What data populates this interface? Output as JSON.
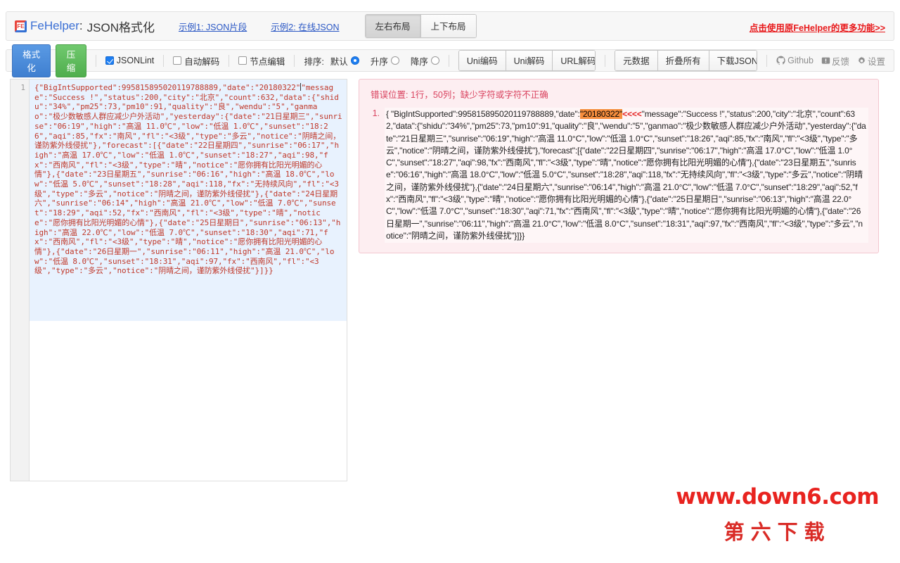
{
  "header": {
    "brand_logo_text": "FE",
    "brand_name": "FeHelper",
    "brand_colon": ":",
    "brand_title": "JSON格式化",
    "links": [
      {
        "label": "示例1: JSON片段"
      },
      {
        "label": "示例2: 在线JSON"
      }
    ],
    "layout_buttons": [
      {
        "label": "左右布局",
        "active": true
      },
      {
        "label": "上下布局",
        "active": false
      }
    ],
    "right_link": "点击使用原FeHelper的更多功能>>"
  },
  "toolbar": {
    "format_label": "格式化",
    "compress_label": "压缩",
    "checkboxes": [
      {
        "label": "JSONLint",
        "checked": true
      },
      {
        "label": "自动解码",
        "checked": false
      },
      {
        "label": "节点编辑",
        "checked": false
      }
    ],
    "sort_label": "排序:",
    "sort_options": [
      {
        "label": "默认",
        "checked": true
      },
      {
        "label": "升序",
        "checked": false
      },
      {
        "label": "降序",
        "checked": false
      }
    ],
    "encode_buttons": [
      {
        "label": "Uni编码"
      },
      {
        "label": "Uni解码"
      },
      {
        "label": "URL解码"
      }
    ],
    "action_buttons": [
      {
        "label": "元数据"
      },
      {
        "label": "折叠所有"
      },
      {
        "label": "下载JSON"
      }
    ],
    "right_items": [
      {
        "icon": "github-icon",
        "label": "Github"
      },
      {
        "icon": "feedback-icon",
        "label": "反馈"
      },
      {
        "icon": "gear-icon",
        "label": "设置"
      }
    ]
  },
  "editor": {
    "line_number": "1",
    "content_before_caret": "{\"BigIntSupported\":995815895020119788889,\"date\":\"20180322\"",
    "content_after_caret": "\"message\":\"Success !\",\"status\":200,\"city\":\"北京\",\"count\":632,\"data\":{\"shidu\":\"34%\",\"pm25\":73,\"pm10\":91,\"quality\":\"良\",\"wendu\":\"5\",\"ganmao\":\"极少数敏感人群应减少户外活动\",\"yesterday\":{\"date\":\"21日星期三\",\"sunrise\":\"06:19\",\"high\":\"高温 11.0℃\",\"low\":\"低温 1.0℃\",\"sunset\":\"18:26\",\"aqi\":85,\"fx\":\"南风\",\"fl\":\"<3级\",\"type\":\"多云\",\"notice\":\"阴晴之间，谨防紫外线侵扰\"},\"forecast\":[{\"date\":\"22日星期四\",\"sunrise\":\"06:17\",\"high\":\"高温 17.0℃\",\"low\":\"低温 1.0℃\",\"sunset\":\"18:27\",\"aqi\":98,\"fx\":\"西南风\",\"fl\":\"<3级\",\"type\":\"晴\",\"notice\":\"愿你拥有比阳光明媚的心情\"},{\"date\":\"23日星期五\",\"sunrise\":\"06:16\",\"high\":\"高温 18.0℃\",\"low\":\"低温 5.0℃\",\"sunset\":\"18:28\",\"aqi\":118,\"fx\":\"无持续风向\",\"fl\":\"<3级\",\"type\":\"多云\",\"notice\":\"阴晴之间，谨防紫外线侵扰\"},{\"date\":\"24日星期六\",\"sunrise\":\"06:14\",\"high\":\"高温 21.0℃\",\"low\":\"低温 7.0℃\",\"sunset\":\"18:29\",\"aqi\":52,\"fx\":\"西南风\",\"fl\":\"<3级\",\"type\":\"晴\",\"notice\":\"愿你拥有比阳光明媚的心情\"},{\"date\":\"25日星期日\",\"sunrise\":\"06:13\",\"high\":\"高温 22.0℃\",\"low\":\"低温 7.0℃\",\"sunset\":\"18:30\",\"aqi\":71,\"fx\":\"西南风\",\"fl\":\"<3级\",\"type\":\"晴\",\"notice\":\"愿你拥有比阳光明媚的心情\"},{\"date\":\"26日星期一\",\"sunrise\":\"06:11\",\"high\":\"高温 21.0℃\",\"low\":\"低温 8.0℃\",\"sunset\":\"18:31\",\"aqi\":97,\"fx\":\"西南风\",\"fl\":\"<3级\",\"type\":\"多云\",\"notice\":\"阴晴之间，谨防紫外线侵扰\"}]}}"
  },
  "error_panel": {
    "title": "错误位置: 1行，50列；缺少字符或字符不正确",
    "item_number": "1.",
    "text_before_highlight": "{ \"BigIntSupported\":995815895020119788889,\"date\":",
    "highlight": "\"20180322\"",
    "marker": "<<<<",
    "text_after_highlight": "\"message\":\"Success !\",\"status\":200,\"city\":\"北京\",\"count\":632,\"data\":{\"shidu\":\"34%\",\"pm25\":73,\"pm10\":91,\"quality\":\"良\",\"wendu\":\"5\",\"ganmao\":\"极少数敏感人群应减少户外活动\",\"yesterday\":{\"date\":\"21日星期三\",\"sunrise\":\"06:19\",\"high\":\"高温 11.0°C\",\"low\":\"低温 1.0°C\",\"sunset\":\"18:26\",\"aqi\":85,\"fx\":\"南风\",\"fl\":\"<3级\",\"type\":\"多云\",\"notice\":\"阴晴之间，谨防紫外线侵扰\"},\"forecast\":[{\"date\":\"22日星期四\",\"sunrise\":\"06:17\",\"high\":\"高温 17.0°C\",\"low\":\"低温 1.0°C\",\"sunset\":\"18:27\",\"aqi\":98,\"fx\":\"西南风\",\"fl\":\"<3级\",\"type\":\"晴\",\"notice\":\"愿你拥有比阳光明媚的心情\"},{\"date\":\"23日星期五\",\"sunrise\":\"06:16\",\"high\":\"高温 18.0°C\",\"low\":\"低温 5.0°C\",\"sunset\":\"18:28\",\"aqi\":118,\"fx\":\"无持续风向\",\"fl\":\"<3级\",\"type\":\"多云\",\"notice\":\"阴晴之间，谨防紫外线侵扰\"},{\"date\":\"24日星期六\",\"sunrise\":\"06:14\",\"high\":\"高温 21.0°C\",\"low\":\"低温 7.0°C\",\"sunset\":\"18:29\",\"aqi\":52,\"fx\":\"西南风\",\"fl\":\"<3级\",\"type\":\"晴\",\"notice\":\"愿你拥有比阳光明媚的心情\"},{\"date\":\"25日星期日\",\"sunrise\":\"06:13\",\"high\":\"高温 22.0°C\",\"low\":\"低温 7.0°C\",\"sunset\":\"18:30\",\"aqi\":71,\"fx\":\"西南风\",\"fl\":\"<3级\",\"type\":\"晴\",\"notice\":\"愿你拥有比阳光明媚的心情\"},{\"date\":\"26日星期一\",\"sunrise\":\"06:11\",\"high\":\"高温 21.0°C\",\"low\":\"低温 8.0°C\",\"sunset\":\"18:31\",\"aqi\":97,\"fx\":\"西南风\",\"fl\":\"<3级\",\"type\":\"多云\",\"notice\":\"阴晴之间，谨防紫外线侵扰\"}]}}"
  },
  "watermark": {
    "url": "www.down6.com",
    "cn": "第六下载"
  },
  "colors": {
    "brand_blue": "#3b6fd4",
    "error_red": "#d9435f",
    "highlight_orange": "#f58d3d",
    "accent_blue": "#1d7ef2",
    "watermark_red": "#e8231f"
  }
}
